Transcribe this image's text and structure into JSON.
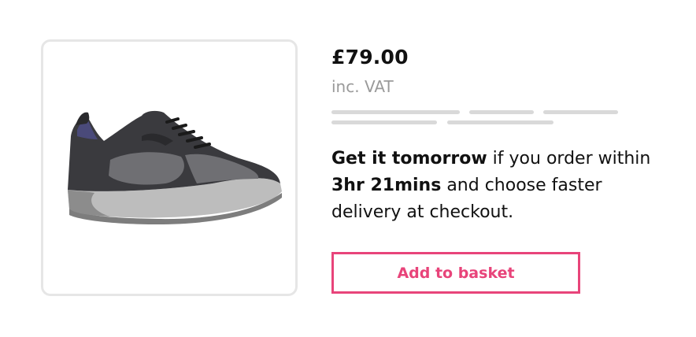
{
  "product": {
    "image_icon": "shoe-image",
    "price": "£79.00",
    "vat_note": "inc. VAT"
  },
  "delivery": {
    "part1_bold": "Get it tomorrow",
    "part2": " if you order within ",
    "part3_bold": "3hr 21mins",
    "part4": " and choose faster delivery at checkout."
  },
  "actions": {
    "add_to_basket_label": "Add to basket"
  },
  "colors": {
    "accent": "#e8447a",
    "border": "#e6e6e6",
    "muted_text": "#9a9a9a",
    "placeholder": "#d9d9d9"
  }
}
